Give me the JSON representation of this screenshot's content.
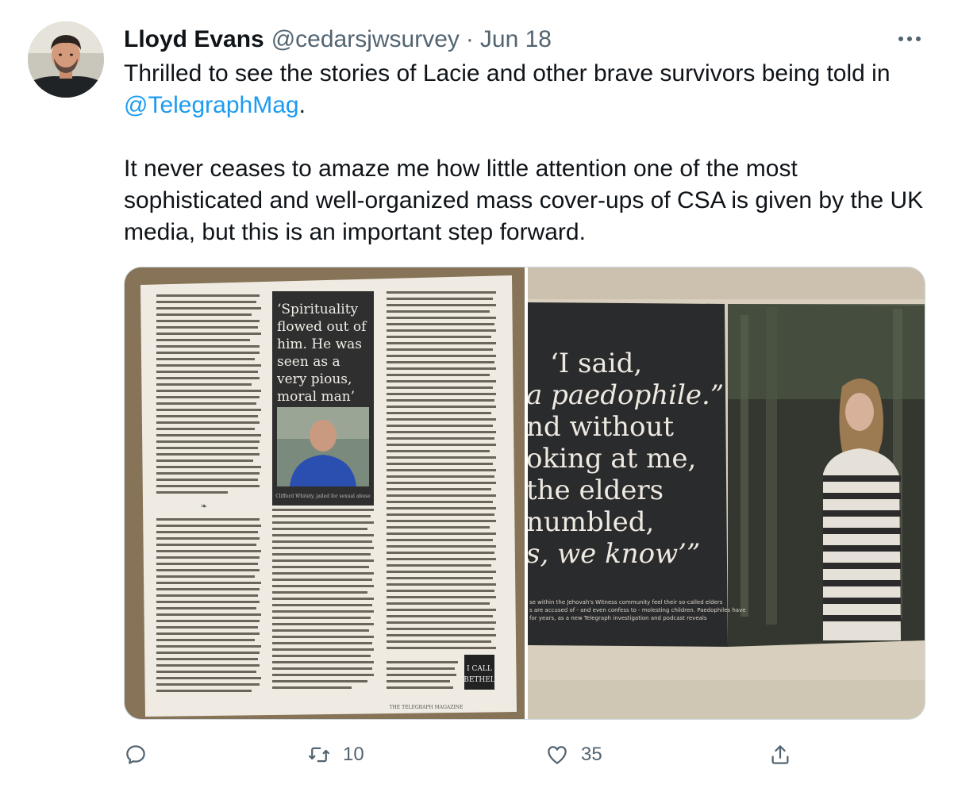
{
  "tweet": {
    "author_name": "Lloyd Evans",
    "handle": "@cedarsjwsurvey",
    "separator": "·",
    "date": "Jun 18",
    "text_line1": "Thrilled to see the stories of Lacie and other brave survivors being told in",
    "mention": "@TelegraphMag",
    "mention_suffix": ".",
    "text_para2": "It never ceases to amaze me how little attention one of the most sophisticated and well-organized mass cover-ups of CSA is given by the UK media, but this is an important step forward."
  },
  "media": {
    "left_quote": [
      "‘Spirituality",
      "flowed out of",
      "him. He was",
      "seen as a",
      "very pious,",
      "moral man’"
    ],
    "left_caption": "Clifford Whitely, jailed for sexual abuse",
    "left_footer": "THE TELEGRAPH MAGAZINE",
    "left_badge": [
      "I CALL",
      "BETHEL"
    ],
    "right_quote": [
      "‘I said,",
      "a paedophile.”",
      "nd without",
      "oking at me,",
      "the elders",
      "numbled,",
      "s, we know’”"
    ],
    "right_caption": [
      "se within the Jehovah's Witness community feel their so-called elders",
      "s are accused of - and even confess to - molesting children. Paedophiles have",
      "for years, as a new Telegraph investigation and podcast reveals"
    ]
  },
  "actions": {
    "reply_icon": "reply-icon",
    "retweet_icon": "retweet-icon",
    "retweet_count": "10",
    "like_icon": "heart-icon",
    "like_count": "35",
    "share_icon": "share-icon"
  },
  "colors": {
    "text": "#0f1419",
    "secondary": "#536471",
    "link": "#1d9bf0",
    "border": "#cfd9de"
  }
}
